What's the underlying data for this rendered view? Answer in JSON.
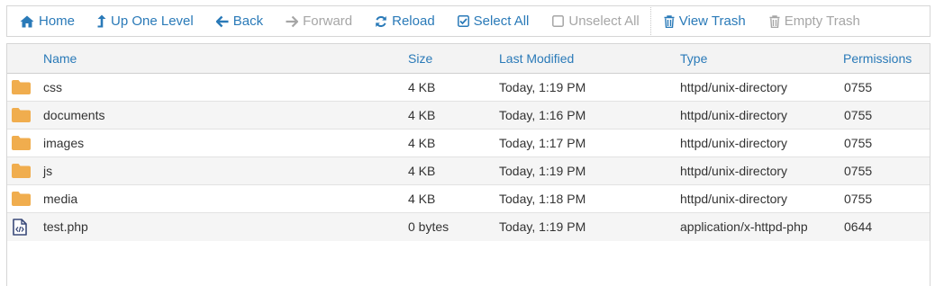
{
  "toolbar": {
    "home": "Home",
    "up_one_level": "Up One Level",
    "back": "Back",
    "forward": "Forward",
    "reload": "Reload",
    "select_all": "Select All",
    "unselect_all": "Unselect All",
    "view_trash": "View Trash",
    "empty_trash": "Empty Trash"
  },
  "columns": {
    "name": "Name",
    "size": "Size",
    "last_modified": "Last Modified",
    "type": "Type",
    "permissions": "Permissions"
  },
  "files": [
    {
      "icon": "folder-icon",
      "name": "css",
      "size": "4 KB",
      "modified": "Today, 1:19 PM",
      "type": "httpd/unix-directory",
      "perms": "0755"
    },
    {
      "icon": "folder-icon",
      "name": "documents",
      "size": "4 KB",
      "modified": "Today, 1:16 PM",
      "type": "httpd/unix-directory",
      "perms": "0755"
    },
    {
      "icon": "folder-icon",
      "name": "images",
      "size": "4 KB",
      "modified": "Today, 1:17 PM",
      "type": "httpd/unix-directory",
      "perms": "0755"
    },
    {
      "icon": "folder-icon",
      "name": "js",
      "size": "4 KB",
      "modified": "Today, 1:19 PM",
      "type": "httpd/unix-directory",
      "perms": "0755"
    },
    {
      "icon": "folder-icon",
      "name": "media",
      "size": "4 KB",
      "modified": "Today, 1:18 PM",
      "type": "httpd/unix-directory",
      "perms": "0755"
    },
    {
      "icon": "php-file-icon",
      "name": "test.php",
      "size": "0 bytes",
      "modified": "Today, 1:19 PM",
      "type": "application/x-httpd-php",
      "perms": "0644"
    }
  ],
  "colors": {
    "link": "#2a7ab8",
    "disabled": "#a6a6a6",
    "folder": "#f0ad4e",
    "header_bg": "#f3f3f3",
    "alt_row_bg": "#f5f5f5"
  }
}
